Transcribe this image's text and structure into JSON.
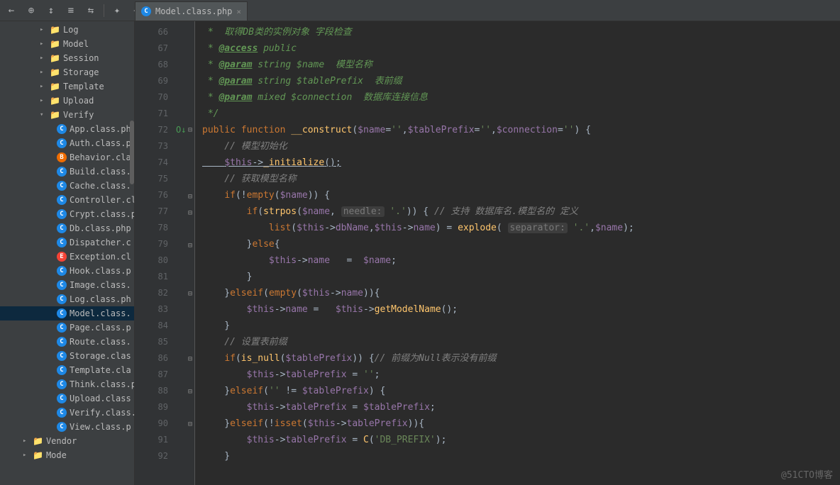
{
  "tab": {
    "label": "Model.class.php",
    "icon": "C"
  },
  "toolbar": [
    "←",
    "⊕",
    "↕",
    "≡",
    "⇆",
    "✦",
    "–"
  ],
  "tree": {
    "folders": [
      {
        "name": "Log",
        "depth": 2,
        "expand": ">"
      },
      {
        "name": "Model",
        "depth": 2,
        "expand": ">"
      },
      {
        "name": "Session",
        "depth": 2,
        "expand": ">"
      },
      {
        "name": "Storage",
        "depth": 2,
        "expand": ">"
      },
      {
        "name": "Template",
        "depth": 2,
        "expand": ">"
      },
      {
        "name": "Upload",
        "depth": 2,
        "expand": ">"
      },
      {
        "name": "Verify",
        "depth": 2,
        "expand": "v"
      }
    ],
    "files": [
      {
        "name": "App.class.ph",
        "icon": "c"
      },
      {
        "name": "Auth.class.p",
        "icon": "c"
      },
      {
        "name": "Behavior.cla",
        "icon": "b"
      },
      {
        "name": "Build.class.p",
        "icon": "c"
      },
      {
        "name": "Cache.class.",
        "icon": "c"
      },
      {
        "name": "Controller.cl",
        "icon": "c"
      },
      {
        "name": "Crypt.class.p",
        "icon": "c"
      },
      {
        "name": "Db.class.php",
        "icon": "c"
      },
      {
        "name": "Dispatcher.c",
        "icon": "c"
      },
      {
        "name": "Exception.cl",
        "icon": "e"
      },
      {
        "name": "Hook.class.p",
        "icon": "c"
      },
      {
        "name": "Image.class.",
        "icon": "c"
      },
      {
        "name": "Log.class.ph",
        "icon": "c"
      },
      {
        "name": "Model.class.",
        "icon": "c",
        "selected": true
      },
      {
        "name": "Page.class.p",
        "icon": "c"
      },
      {
        "name": "Route.class.",
        "icon": "c"
      },
      {
        "name": "Storage.clas",
        "icon": "c"
      },
      {
        "name": "Template.cla",
        "icon": "c"
      },
      {
        "name": "Think.class.p",
        "icon": "c"
      },
      {
        "name": "Upload.class",
        "icon": "c"
      },
      {
        "name": "Verify.class.p",
        "icon": "c"
      },
      {
        "name": "View.class.p",
        "icon": "c"
      }
    ],
    "bottom_folders": [
      {
        "name": "Vendor",
        "depth": 1,
        "expand": ">"
      },
      {
        "name": "Mode",
        "depth": 1,
        "expand": ">"
      }
    ]
  },
  "lines": [
    "66",
    "67",
    "68",
    "69",
    "70",
    "71",
    "72",
    "73",
    "74",
    "75",
    "76",
    "77",
    "78",
    "79",
    "80",
    "81",
    "82",
    "83",
    "84",
    "85",
    "86",
    "87",
    "88",
    "89",
    "90",
    "91",
    "92"
  ],
  "code": {
    "l66": " *  取得DB类的实例对象 字段检查",
    "l67a": " * ",
    "l67b": "@access",
    "l67c": " public",
    "l68a": " * ",
    "l68b": "@param",
    "l68c": " string $name  模型名称",
    "l69a": " * ",
    "l69b": "@param",
    "l69c": " string $tablePrefix  表前缀",
    "l70a": " * ",
    "l70b": "@param",
    "l70c": " mixed $connection  数据库连接信息",
    "l71": " */",
    "l72a": "public",
    "l72b": " function ",
    "l72c": "__construct",
    "l72d": "(",
    "l72e": "$name",
    "l72f": "=",
    "l72g": "''",
    "l72h": ",",
    "l72i": "$tablePrefix",
    "l72j": "=",
    "l72k": "''",
    "l72l": ",",
    "l72m": "$connection",
    "l72n": "=",
    "l72o": "''",
    "l72p": ") {",
    "l73": "    // 模型初始化",
    "l74a": "    ",
    "l74b": "$this",
    "l74c": "->",
    "l74d": "_initialize",
    "l74e": "();",
    "l75": "    // 获取模型名称",
    "l76a": "    ",
    "l76b": "if",
    "l76c": "(!",
    "l76d": "empty",
    "l76e": "(",
    "l76f": "$name",
    "l76g": ")) {",
    "l77a": "        ",
    "l77b": "if",
    "l77c": "(",
    "l77d": "strpos",
    "l77e": "(",
    "l77f": "$name",
    "l77g": ", ",
    "l77h": "needle:",
    "l77i": " ",
    "l77j": "'.'",
    "l77k": ")) { ",
    "l77l": "// 支持 数据库名.模型名的 定义",
    "l78a": "            ",
    "l78b": "list",
    "l78c": "(",
    "l78d": "$this",
    "l78e": "->",
    "l78f": "dbName",
    "l78g": ",",
    "l78h": "$this",
    "l78i": "->",
    "l78j": "name",
    "l78k": ") = ",
    "l78l": "explode",
    "l78m": "( ",
    "l78n": "separator:",
    "l78o": " ",
    "l78p": "'.'",
    "l78q": ",",
    "l78r": "$name",
    "l78s": ");",
    "l79a": "        }",
    "l79b": "else",
    "l79c": "{",
    "l80a": "            ",
    "l80b": "$this",
    "l80c": "->",
    "l80d": "name",
    "l80e": "   =  ",
    "l80f": "$name",
    "l80g": ";",
    "l81": "        }",
    "l82a": "    }",
    "l82b": "elseif",
    "l82c": "(",
    "l82d": "empty",
    "l82e": "(",
    "l82f": "$this",
    "l82g": "->",
    "l82h": "name",
    "l82i": ")){",
    "l83a": "        ",
    "l83b": "$this",
    "l83c": "->",
    "l83d": "name",
    "l83e": " =   ",
    "l83f": "$this",
    "l83g": "->",
    "l83h": "getModelName",
    "l83i": "();",
    "l84": "    }",
    "l85": "    // 设置表前缀",
    "l86a": "    ",
    "l86b": "if",
    "l86c": "(",
    "l86d": "is_null",
    "l86e": "(",
    "l86f": "$tablePrefix",
    "l86g": ")) {",
    "l86h": "// 前缀为Null表示没有前缀",
    "l87a": "        ",
    "l87b": "$this",
    "l87c": "->",
    "l87d": "tablePrefix",
    "l87e": " = ",
    "l87f": "''",
    "l87g": ";",
    "l88a": "    }",
    "l88b": "elseif",
    "l88c": "(",
    "l88d": "''",
    "l88e": " != ",
    "l88f": "$tablePrefix",
    "l88g": ") {",
    "l89a": "        ",
    "l89b": "$this",
    "l89c": "->",
    "l89d": "tablePrefix",
    "l89e": " = ",
    "l89f": "$tablePrefix",
    "l89g": ";",
    "l90a": "    }",
    "l90b": "elseif",
    "l90c": "(!",
    "l90d": "isset",
    "l90e": "(",
    "l90f": "$this",
    "l90g": "->",
    "l90h": "tablePrefix",
    "l90i": ")){",
    "l91a": "        ",
    "l91b": "$this",
    "l91c": "->",
    "l91d": "tablePrefix",
    "l91e": " = ",
    "l91f": "C",
    "l91g": "(",
    "l91h": "'DB_PREFIX'",
    "l91i": ");",
    "l92": "    }"
  },
  "watermark": "@51CTO博客",
  "override_mark": "O↓"
}
